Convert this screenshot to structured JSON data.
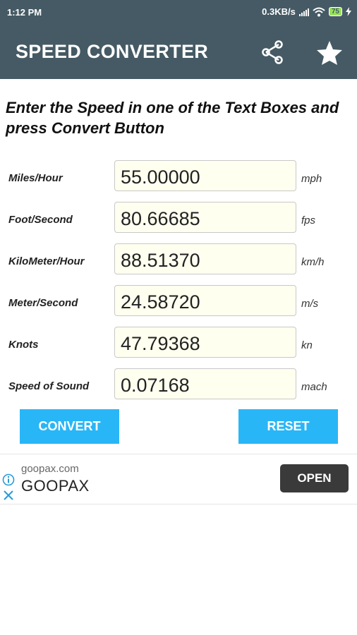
{
  "status_bar": {
    "time": "1:12 PM",
    "network_speed": "0.3KB/s",
    "battery_level": "75"
  },
  "app_bar": {
    "title": "SPEED CONVERTER",
    "share_icon": "share-icon",
    "star_icon": "star-icon"
  },
  "instructions": "Enter the Speed in one of the Text Boxes and press Convert Button",
  "rows": [
    {
      "label": "Miles/Hour",
      "value": "55.00000",
      "unit": "mph"
    },
    {
      "label": "Foot/Second",
      "value": "80.66685",
      "unit": "fps"
    },
    {
      "label": "KiloMeter/Hour",
      "value": "88.51370",
      "unit": "km/h"
    },
    {
      "label": "Meter/Second",
      "value": "24.58720",
      "unit": "m/s"
    },
    {
      "label": "Knots",
      "value": "47.79368",
      "unit": "kn"
    },
    {
      "label": "Speed of Sound",
      "value": "0.07168",
      "unit": "mach"
    }
  ],
  "buttons": {
    "convert": "CONVERT",
    "reset": "RESET"
  },
  "ad": {
    "domain": "goopax.com",
    "brand": "GOOPAX",
    "open_label": "OPEN"
  },
  "colors": {
    "app_bar": "#455a64",
    "button": "#29b6f6",
    "field_bg": "#fffff0",
    "ad_button": "#3a3a3a"
  }
}
